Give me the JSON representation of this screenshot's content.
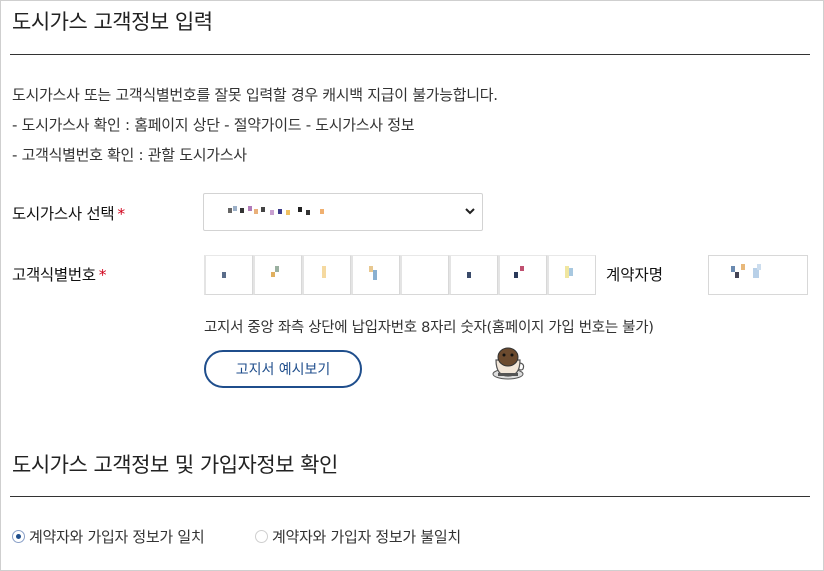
{
  "section1": {
    "title": "도시가스 고객정보 입력"
  },
  "notice": {
    "line1": "도시가스사 또는 고객식별번호를 잘못 입력할 경우 캐시백 지급이 불가능합니다.",
    "line2": "- 도시가스사 확인 : 홈페이지 상단 - 절약가이드 - 도시가스사 정보",
    "line3": "- 고객식별번호 확인 : 관할 도시가스사"
  },
  "gas_company": {
    "label": "도시가스사 선택",
    "required_mark": "*"
  },
  "customer_id": {
    "label": "고객식별번호",
    "required_mark": "*",
    "digit_count": 8,
    "hint": "고지서 중앙 좌측 상단에 납입자번호 8자리 숫자(홈페이지 가입 번호는 불가)",
    "example_button": "고지서 예시보기"
  },
  "contractor": {
    "label": "계약자명"
  },
  "section2": {
    "title": "도시가스 고객정보 및 가입자정보 확인"
  },
  "match_options": [
    {
      "label": "계약자와 가입자 정보가 일치",
      "selected": true
    },
    {
      "label": "계약자와 가입자 정보가 불일치",
      "selected": false
    }
  ],
  "colors": {
    "accent": "#1f4e8c",
    "required": "#d0021b",
    "border": "#d3d3d3"
  }
}
